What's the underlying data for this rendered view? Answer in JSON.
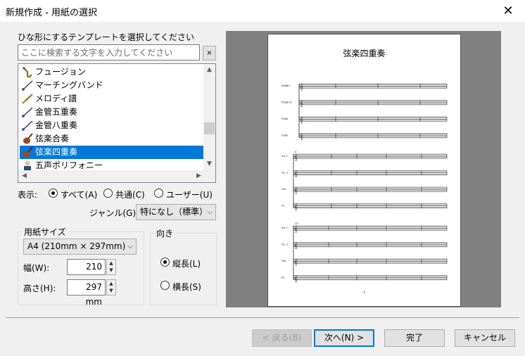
{
  "window": {
    "title": "新規作成 - 用紙の選択"
  },
  "template_section": {
    "label": "ひな形にするテンプレートを選択してください",
    "search_placeholder": "ここに検索する文字を入力してください",
    "clear_label": "×"
  },
  "templates": [
    {
      "label": "フュージョン",
      "icon": "saxophone-icon"
    },
    {
      "label": "マーチングバンド",
      "icon": "baton-icon"
    },
    {
      "label": "メロディ譜",
      "icon": "flute-icon"
    },
    {
      "label": "金管五重奏",
      "icon": "baton-icon"
    },
    {
      "label": "金管八重奏",
      "icon": "baton-icon"
    },
    {
      "label": "弦楽合奏",
      "icon": "violin-icon"
    },
    {
      "label": "弦楽四重奏",
      "icon": "violin-icon",
      "selected": true
    },
    {
      "label": "五声ポリフォニー",
      "icon": "singer-icon"
    }
  ],
  "filter": {
    "label": "表示:",
    "options": [
      "すべて(A)",
      "共通(C)",
      "ユーザー(U)"
    ],
    "selected": 0
  },
  "genre": {
    "label": "ジャンル(G):",
    "value": "特になし（標準）"
  },
  "paper": {
    "group_label": "用紙サイズ",
    "size_value": "A4 (210mm × 297mm)",
    "width_label": "幅(W):",
    "width_value": "210 mm",
    "height_label": "高さ(H):",
    "height_value": "297 mm"
  },
  "orientation": {
    "group_label": "向き",
    "portrait": "縦長(L)",
    "landscape": "横長(S)",
    "selected": "portrait"
  },
  "preview": {
    "score_title": "弦楽四重奏",
    "system1_parts": [
      "Violin I",
      "Violin II",
      "Viola",
      "Cello"
    ],
    "system2_parts": [
      "Vn. I",
      "Vn. 2",
      "Vla.",
      "Vc."
    ],
    "system3_parts": [
      "Vn. I",
      "Vn. 2",
      "Vla.",
      "Vc."
    ],
    "measure_numbers": [
      "5",
      "11"
    ],
    "page_number": "- 1 -"
  },
  "buttons": {
    "back": "< 戻る(B)",
    "next": "次へ(N) >",
    "finish": "完了",
    "cancel": "キャンセル"
  },
  "colors": {
    "selection": "#0078d7",
    "preview_bg": "#808080"
  }
}
